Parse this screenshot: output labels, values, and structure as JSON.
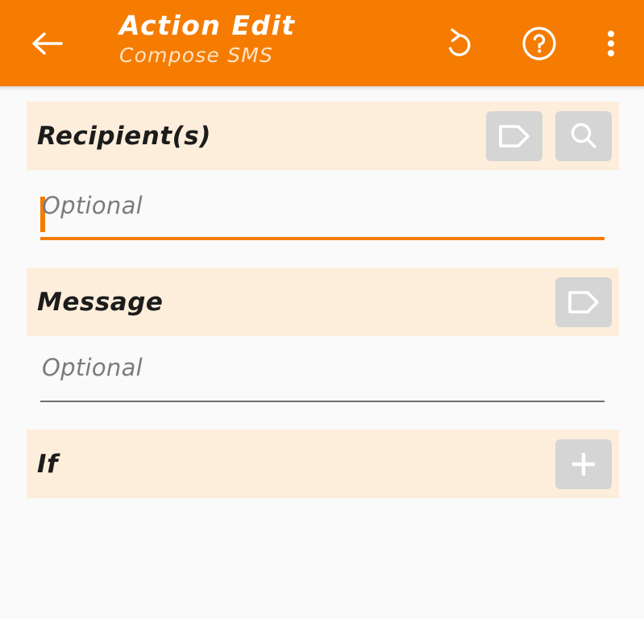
{
  "appbar": {
    "title": "Action Edit",
    "subtitle": "Compose SMS",
    "background_color": "#f57c00",
    "back_icon": "back-arrow-icon",
    "actions": [
      {
        "name": "undo-icon",
        "label": "Undo"
      },
      {
        "name": "help-icon",
        "label": "Help"
      },
      {
        "name": "overflow-menu-icon",
        "label": "More options"
      }
    ]
  },
  "sections": {
    "recipients": {
      "label": "Recipient(s)",
      "buttons": [
        {
          "name": "tag-icon",
          "label": "Tag"
        },
        {
          "name": "search-icon",
          "label": "Search"
        }
      ],
      "input": {
        "value": "",
        "placeholder": "Optional",
        "focused": true
      }
    },
    "message": {
      "label": "Message",
      "buttons": [
        {
          "name": "tag-icon",
          "label": "Tag"
        }
      ],
      "input": {
        "value": "",
        "placeholder": "Optional",
        "focused": false
      }
    },
    "condition": {
      "label": "If",
      "buttons": [
        {
          "name": "plus-icon",
          "label": "Add condition"
        }
      ]
    }
  },
  "colors": {
    "accent": "#f57c00",
    "section_band": "#fdeedc",
    "page_background": "#fafafa",
    "icon_button": "#d5d5d5",
    "placeholder_text": "#7b7b7b"
  }
}
